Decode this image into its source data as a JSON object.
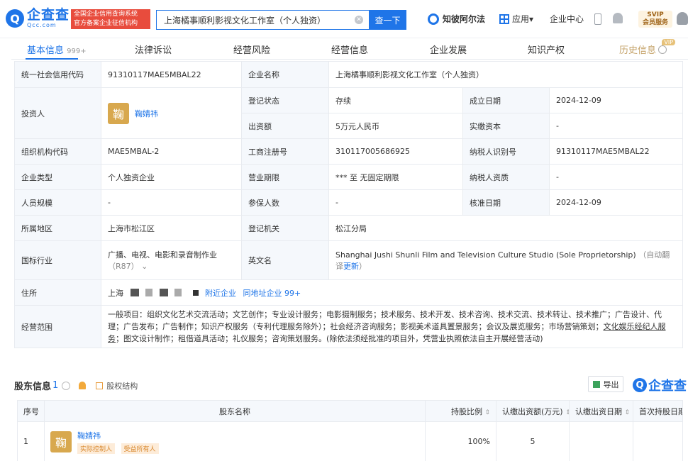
{
  "header": {
    "logo_cn": "企查查",
    "logo_en": "Qcc.com",
    "logo_mark": "Q",
    "tag_line1": "全国企业信用查询系统",
    "tag_line2": "官方备案企业征信机构",
    "search_value": "上海橘事顺利影视文化工作室（个人独资）",
    "search_button": "查一下",
    "nav_zhi": "知彼阿尔法",
    "nav_app": "应用",
    "nav_app_caret": "▾",
    "nav_enterprise": "企业中心",
    "svip_line1": "SVIP",
    "svip_line2": "会员服务"
  },
  "tabs": [
    {
      "label": "基本信息",
      "count": "999+"
    },
    {
      "label": "法律诉讼"
    },
    {
      "label": "经营风险"
    },
    {
      "label": "经营信息"
    },
    {
      "label": "企业发展"
    },
    {
      "label": "知识产权"
    },
    {
      "label": "历史信息",
      "badge": "VIP"
    }
  ],
  "info": {
    "credit_code_label": "统一社会信用代码",
    "credit_code": "91310117MAE5MBAL22",
    "name_label": "企业名称",
    "name": "上海橘事顺利影视文化工作室（个人独资）",
    "investor_label": "投资人",
    "investor_avatar": "鞠",
    "investor": "鞠婧祎",
    "status_label": "登记状态",
    "status": "存续",
    "established_label": "成立日期",
    "established": "2024-12-09",
    "capital_label": "出资额",
    "capital": "5万元人民币",
    "paid_label": "实缴资本",
    "paid": "-",
    "org_code_label": "组织机构代码",
    "org_code": "MAE5MBAL-2",
    "reg_no_label": "工商注册号",
    "reg_no": "310117005686925",
    "taxpayer_id_label": "纳税人识别号",
    "taxpayer_id": "91310117MAE5MBAL22",
    "type_label": "企业类型",
    "type": "个人独资企业",
    "term_label": "营业期限",
    "term": "*** 至 无固定期限",
    "taxpayer_qual_label": "纳税人资质",
    "taxpayer_qual": "-",
    "staff_label": "人员规模",
    "staff": "-",
    "insured_label": "参保人数",
    "insured": "-",
    "approved_label": "核准日期",
    "approved": "2024-12-09",
    "region_label": "所属地区",
    "region": "上海市松江区",
    "authority_label": "登记机关",
    "authority": "松江分局",
    "industry_label": "国标行业",
    "industry_line1": "广播、电视、电影和录音制作业",
    "industry_line2": "（R87）",
    "english_label": "英文名",
    "english": "Shanghai Jushi Shunli Film and Television Culture Studio (Sole Proprietorship)",
    "auto_translate": "（自动翻译",
    "update": "更新",
    "update_close": "）",
    "address_label": "住所",
    "address_prefix": "上海",
    "nearby": "附近企业",
    "same_address": "同地址企业 99+",
    "scope_label": "经营范围",
    "scope_main": "一般项目：组织文化艺术交流活动；文艺创作；专业设计服务；电影摄制服务；技术服务、技术开发、技术咨询、技术交流、技术转让、技术推广；广告设计、代理；广告发布；广告制作；知识产权服务（专利代理服务除外）；社会经济咨询服务；影视美术道具置景服务；会议及展览服务；市场营销策划；",
    "scope_ul": "文化娱乐经纪人服务",
    "scope_tail": "；图文设计制作；租借道具活动；礼仪服务；咨询策划服务。(除依法须经批准的项目外，凭营业执照依法自主开展经营活动)"
  },
  "shareholders": {
    "title": "股东信息",
    "count": "1",
    "equity_structure": "股权结构",
    "export": "导出",
    "watermark_logo": "Q",
    "watermark": "企查查",
    "columns": [
      "序号",
      "股东名称",
      "持股比例",
      "认缴出资额(万元)",
      "认缴出资日期",
      "首次持股日期"
    ],
    "sort_icon": "⇕",
    "rows": [
      {
        "index": "1",
        "avatar": "鞠",
        "name": "鞠婧祎",
        "tags": [
          "实际控制人",
          "受益所有人"
        ],
        "ratio": "100%",
        "amount": "5"
      }
    ]
  }
}
